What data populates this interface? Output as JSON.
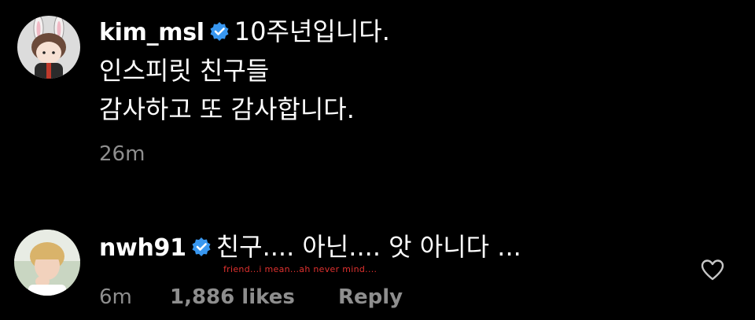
{
  "comments": [
    {
      "username": "kim_msl",
      "verified": true,
      "lines": [
        "10주년입니다.",
        "인스피릿 친구들",
        "감사하고 또 감사합니다."
      ],
      "time": "26m"
    },
    {
      "username": "nwh91",
      "verified": true,
      "text": "친구.... 아닌.... 앗 아니다 ...",
      "translation_caption": "friend...i mean...ah never mind....",
      "time": "6m",
      "likes": "1,886 likes",
      "reply_label": "Reply"
    }
  ],
  "icons": {
    "verified": "verified-badge-icon",
    "like": "heart-icon"
  },
  "colors": {
    "background": "#000000",
    "text": "#ffffff",
    "secondary_text": "#8e8e8e",
    "verified_blue": "#3897f0",
    "caption_red": "#e0312f"
  }
}
